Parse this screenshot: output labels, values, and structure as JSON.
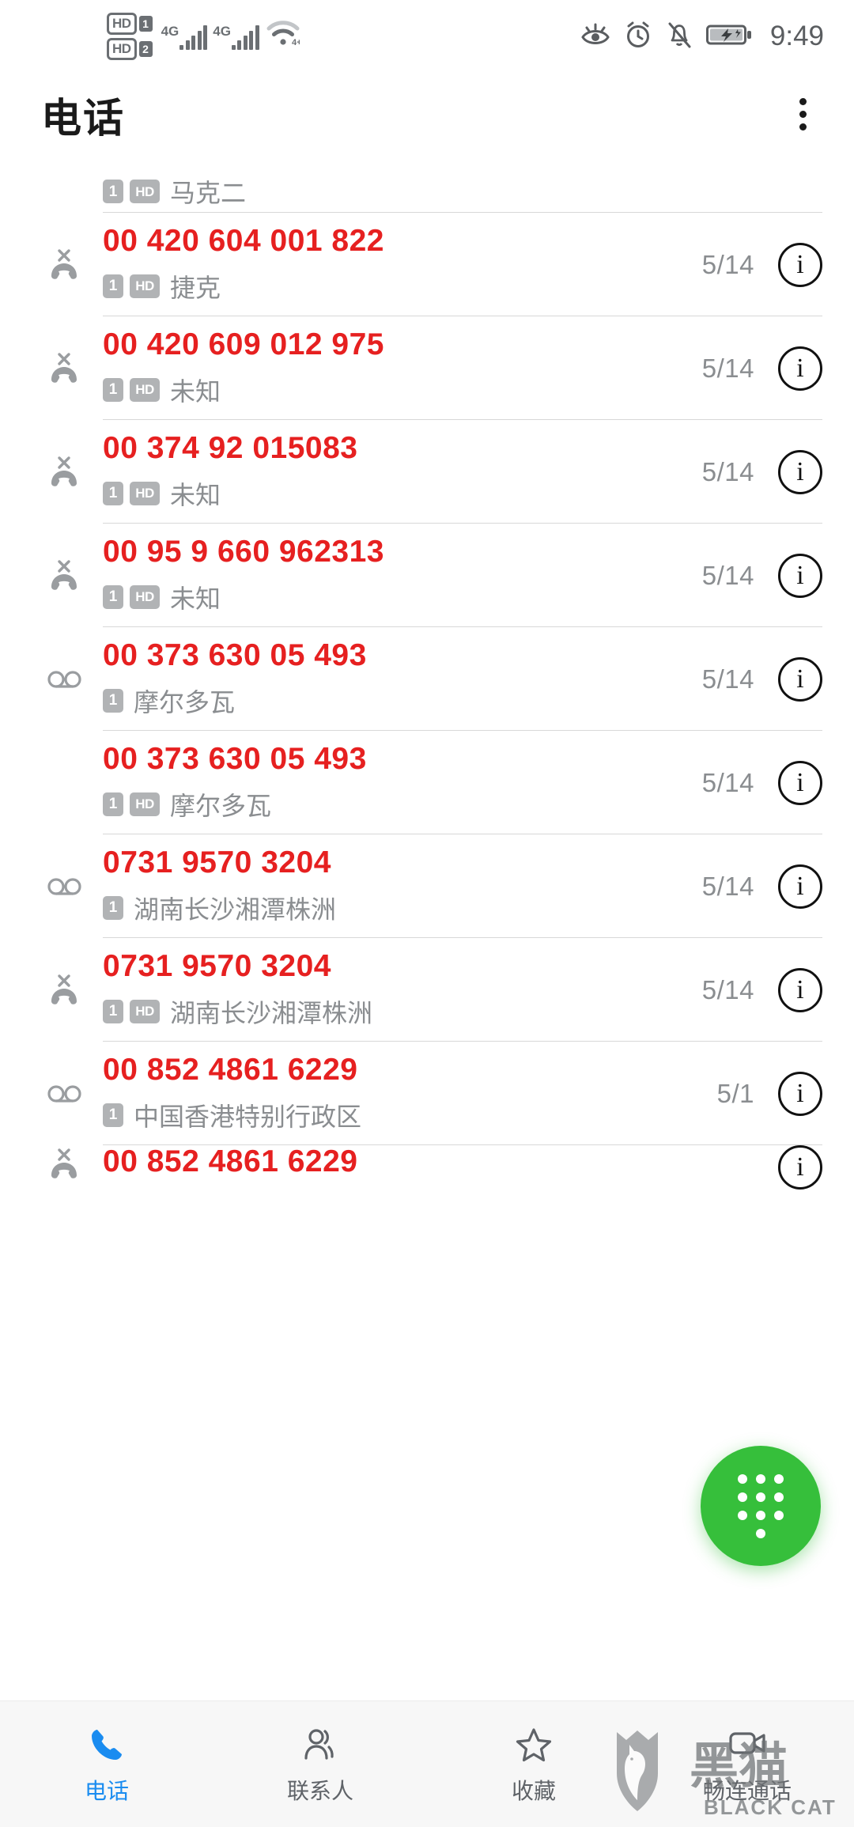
{
  "status_bar": {
    "hd_labels": [
      "HD",
      "HD"
    ],
    "sim_numbers": [
      "1",
      "2"
    ],
    "network_labels": [
      "4G",
      "4G"
    ],
    "icons": [
      "eye-comfort-icon",
      "alarm-clock-icon",
      "bell-muted-icon",
      "battery-charging-icon"
    ],
    "time": "9:49"
  },
  "app_bar": {
    "title": "电话",
    "overflow_menu": "more-options"
  },
  "call_log": {
    "rows": [
      {
        "call_type": "missed",
        "number": "",
        "sim_badge": "1",
        "hd_badge": "HD",
        "location": "马克二",
        "date": "",
        "partial": "top"
      },
      {
        "call_type": "missed",
        "number": "00 420 604 001 822",
        "sim_badge": "1",
        "hd_badge": "HD",
        "location": "捷克",
        "date": "5/14"
      },
      {
        "call_type": "missed",
        "number": "00 420 609 012 975",
        "sim_badge": "1",
        "hd_badge": "HD",
        "location": "未知",
        "date": "5/14"
      },
      {
        "call_type": "missed",
        "number": "00 374 92 015083",
        "sim_badge": "1",
        "hd_badge": "HD",
        "location": "未知",
        "date": "5/14"
      },
      {
        "call_type": "missed",
        "number": "00 95 9 660 962313",
        "sim_badge": "1",
        "hd_badge": "HD",
        "location": "未知",
        "date": "5/14"
      },
      {
        "call_type": "voicemail",
        "number": "00 373 630 05 493",
        "sim_badge": "1",
        "hd_badge": "",
        "location": "摩尔多瓦",
        "date": "5/14"
      },
      {
        "call_type": "none",
        "number": "00 373 630 05 493",
        "sim_badge": "1",
        "hd_badge": "HD",
        "location": "摩尔多瓦",
        "date": "5/14"
      },
      {
        "call_type": "voicemail",
        "number": "0731 9570 3204",
        "sim_badge": "1",
        "hd_badge": "",
        "location": "湖南长沙湘潭株洲",
        "date": "5/14"
      },
      {
        "call_type": "missed",
        "number": "0731 9570 3204",
        "sim_badge": "1",
        "hd_badge": "HD",
        "location": "湖南长沙湘潭株洲",
        "date": "5/14"
      },
      {
        "call_type": "voicemail",
        "number": "00 852 4861 6229",
        "sim_badge": "1",
        "hd_badge": "",
        "location": "中国香港特别行政区",
        "date": "5/1",
        "info_label": "i"
      },
      {
        "call_type": "missed",
        "number": "00 852 4861 6229",
        "sim_badge": "",
        "hd_badge": "",
        "location": "",
        "date": "",
        "partial": "bottom"
      }
    ],
    "info_label": "i"
  },
  "fab": {
    "name": "dialpad-fab",
    "color": "#36bf3b"
  },
  "bottom_nav": {
    "tabs": [
      {
        "label": "电话",
        "icon": "phone-icon",
        "active": true
      },
      {
        "label": "联系人",
        "icon": "contacts-icon",
        "active": false
      },
      {
        "label": "收藏",
        "icon": "star-icon",
        "active": false
      },
      {
        "label": "畅连通话",
        "icon": "video-call-icon",
        "active": false
      }
    ]
  },
  "watermark": {
    "cn_text": "黑猫",
    "en_text": "BLACK CAT"
  },
  "colors": {
    "number_red": "#e62020",
    "accent_blue": "#1a8cf0",
    "fab_green": "#36bf3b",
    "muted_gray": "#8a8d90"
  }
}
